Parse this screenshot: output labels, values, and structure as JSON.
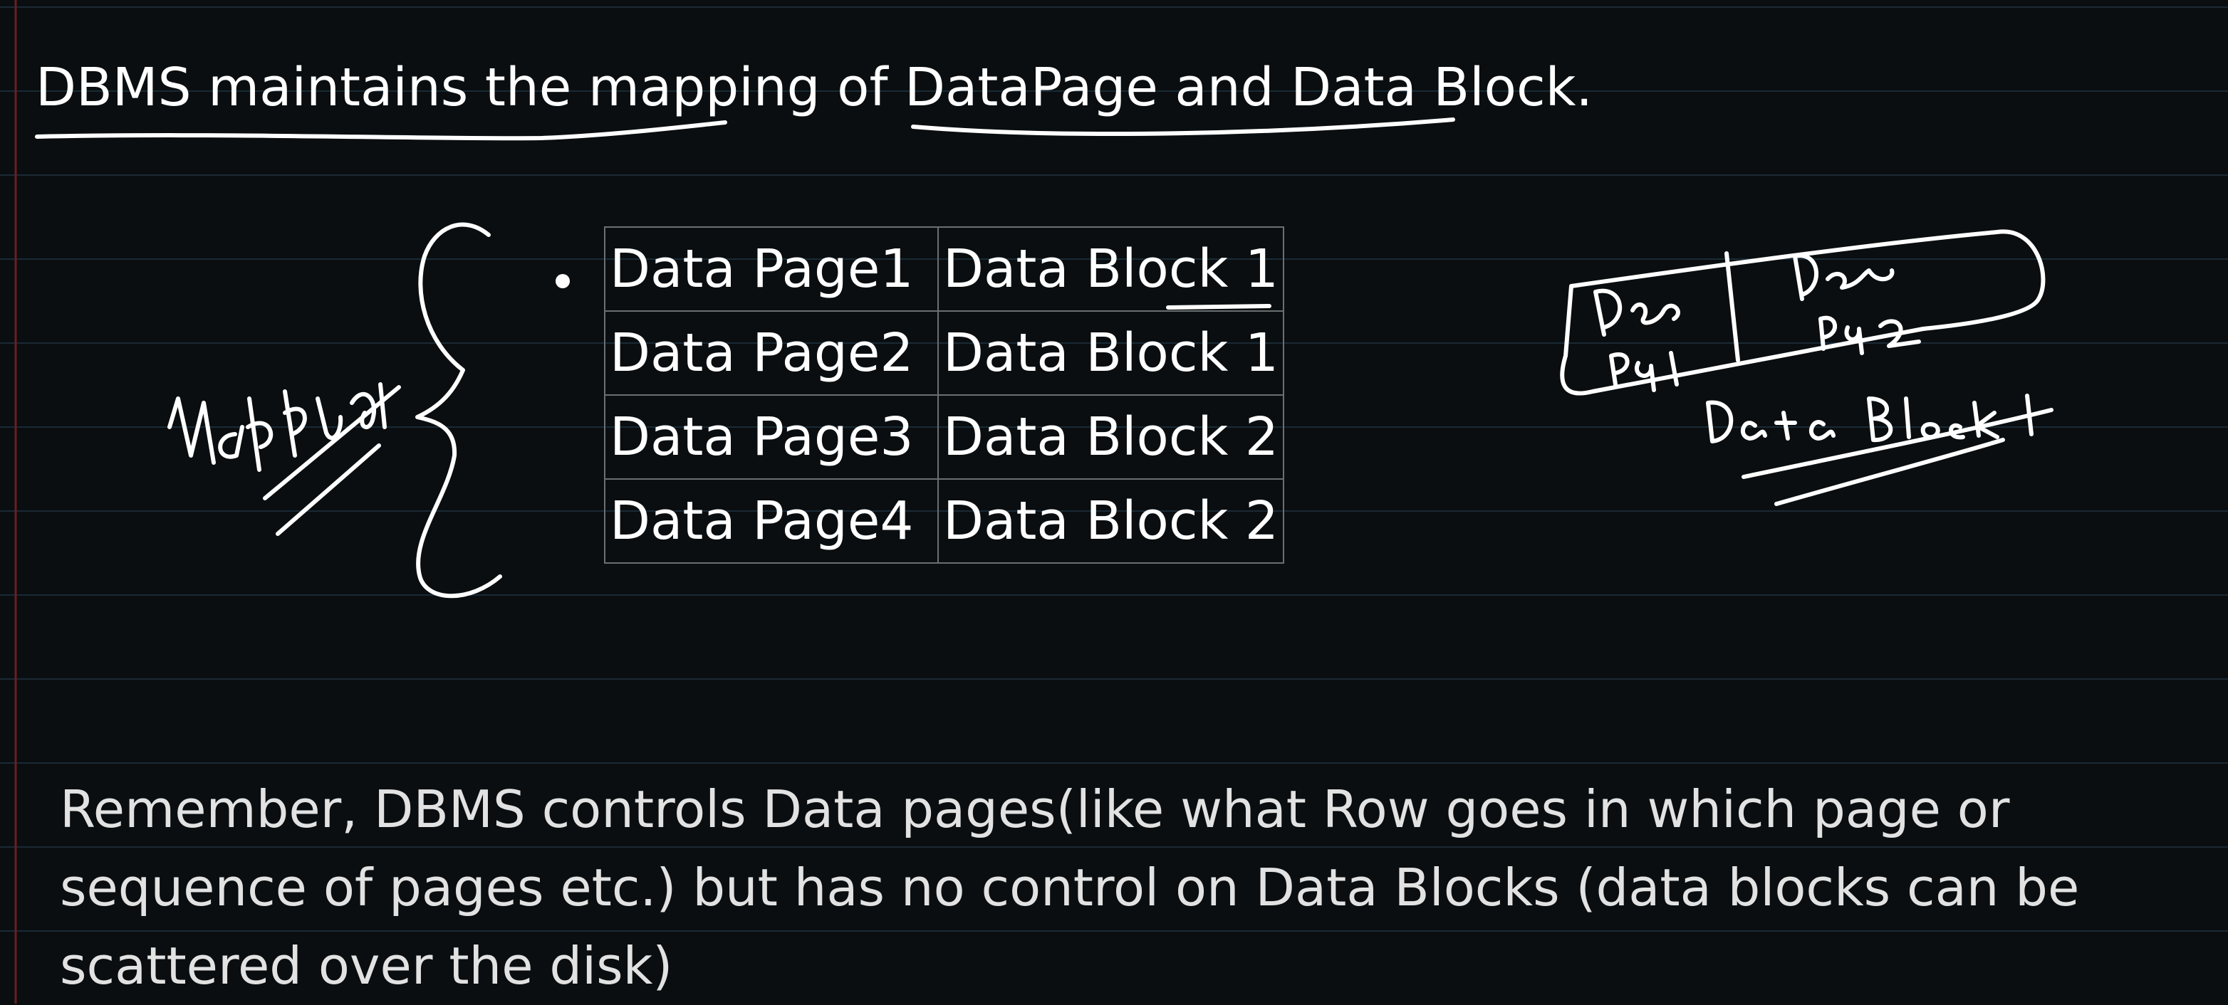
{
  "heading": "DBMS maintains the mapping of DataPage and Data Block.",
  "mapping_table": {
    "rows": [
      {
        "page": "Data Page1",
        "block": "Data Block 1"
      },
      {
        "page": "Data Page2",
        "block": "Data Block 1"
      },
      {
        "page": "Data Page3",
        "block": "Data Block 2"
      },
      {
        "page": "Data Page4",
        "block": "Data Block 2"
      }
    ]
  },
  "note": "Remember, DBMS controls Data pages(like what Row goes in which page or sequence of pages etc.) but has no control on Data Blocks (data blocks can be scattered over the disk)",
  "handwriting": {
    "mapping_label": "Mapping",
    "block_sketch_page_1": "Data Pg 1",
    "block_sketch_page_2": "Data Pg 2",
    "block_sketch_caption": "Data Block 1"
  },
  "colors": {
    "background": "#0a0e10",
    "ruled_line": "#1a2a36",
    "margin_line": "#6b1e22",
    "ink": "#ffffff",
    "table_border": "#6b6f70"
  }
}
